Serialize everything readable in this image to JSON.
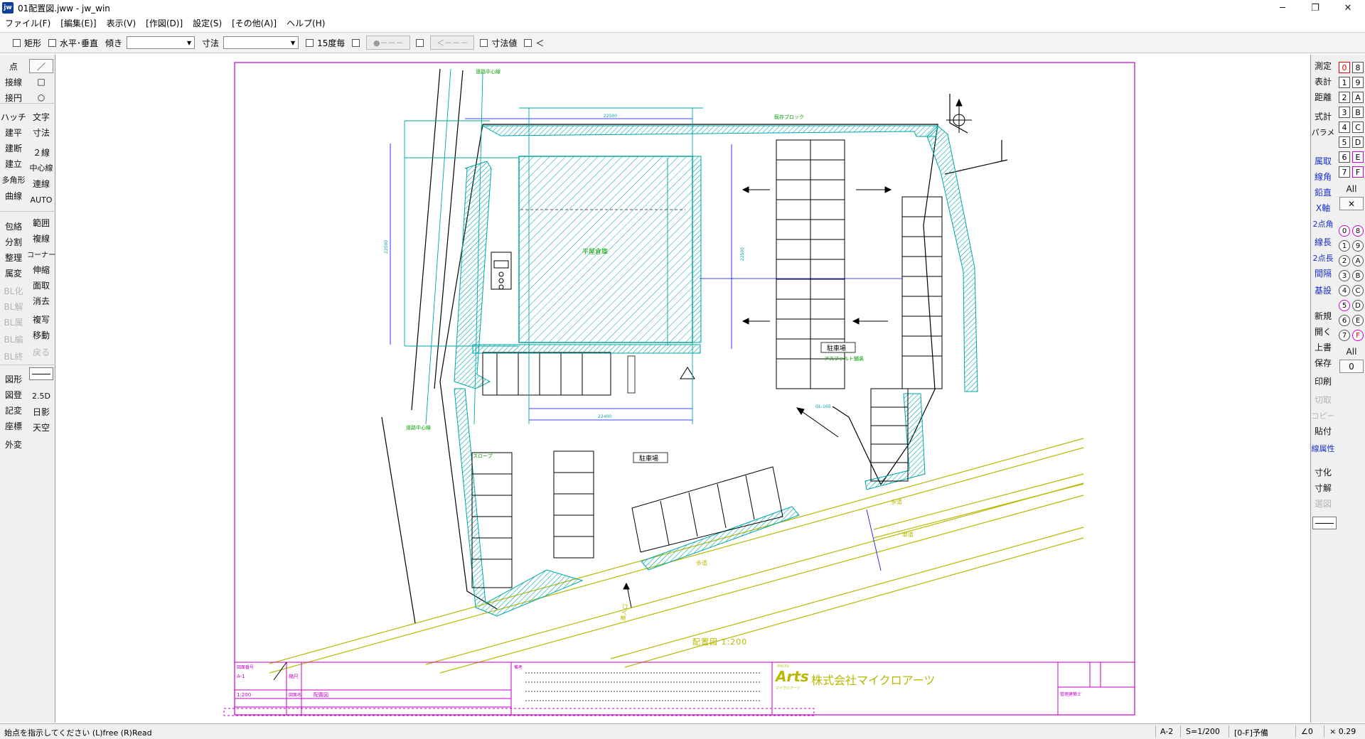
{
  "window": {
    "title": "01配置図.jww - jw_win",
    "icon_label": "jw",
    "controls": [
      "─",
      "❐",
      "✕"
    ]
  },
  "menu": [
    "ファイル(F)",
    "[編集(E)]",
    "表示(V)",
    "[作図(D)]",
    "設定(S)",
    "[その他(A)]",
    "ヘルプ(H)"
  ],
  "options_bar": {
    "rect_label": "矩形",
    "hv_label": "水平･垂直",
    "angle_label": "傾き",
    "dim_label": "寸法",
    "deg15_label": "15度毎",
    "btn1": "●－－－",
    "btn2": "＜－－－",
    "dimval_label": "寸法値",
    "last_label": "＜"
  },
  "left_toolbar": {
    "col1": [
      "点",
      "接線",
      "接円",
      "ハッチ",
      "建平",
      "建断",
      "建立",
      "多角形",
      "曲線",
      "包絡",
      "分割",
      "整理",
      "属変",
      "BL化",
      "BL解",
      "BL属",
      "BL編",
      "BL終",
      "図形",
      "図登",
      "記変",
      "座標",
      "外変"
    ],
    "col2": [
      "／",
      "□",
      "○",
      "文字",
      "寸法",
      "２線",
      "中心線",
      "連線",
      "AUTO",
      "範囲",
      "複線",
      "コーナー",
      "伸縮",
      "面取",
      "消去",
      "複写",
      "移動",
      "戻る",
      "2.5D",
      "日影",
      "天空"
    ]
  },
  "right_toolbar": {
    "cmds_a": [
      "測定",
      "表計",
      "距離",
      "式計",
      "パラメ"
    ],
    "cmds_b": [
      "属取",
      "線角",
      "鉛直",
      "X軸",
      "2点角",
      "線長",
      "2点長",
      "間隔",
      "基設"
    ],
    "cmds_c": [
      "新規",
      "開く",
      "上書",
      "保存",
      "印刷",
      "切取",
      "コピー",
      "貼付",
      "線属性",
      "寸化",
      "寸解",
      "選図"
    ],
    "layers_left": [
      "0",
      "1",
      "2",
      "3",
      "4",
      "5",
      "6",
      "7"
    ],
    "layers_right": [
      "8",
      "9",
      "A",
      "B",
      "C",
      "D",
      "E",
      "F"
    ],
    "layer_all": "All",
    "layer_x": "✕",
    "groups_left": [
      "0",
      "1",
      "2",
      "3",
      "4",
      "5",
      "6",
      "7"
    ],
    "groups_right": [
      "8",
      "9",
      "A",
      "B",
      "C",
      "D",
      "E",
      "F"
    ],
    "group_all": "All",
    "group_zero": "0"
  },
  "drawing": {
    "site_title": "配置図 1:200",
    "parking_label": "駐車場",
    "parking_label2": "駐車場",
    "parking_label3": "駐車場",
    "building_label": "平屋倉庫",
    "road_center": "道路中心線",
    "road_center2": "道路中心線",
    "entrance": "進入口",
    "sidewalk": "歩道",
    "sidewalk2": "歩道",
    "roadway": "車道",
    "block": "既存ブロック",
    "dim_top": "22500",
    "dim_left": "22500",
    "dim_mid": "22500",
    "dim_bottom": "22400",
    "slope": "スロープ",
    "gl_note": "GL-160",
    "asphalt": "アスファルト舗装"
  },
  "title_block": {
    "drawing_no_label": "図面番号",
    "drawing_no": "A-1",
    "scale_label": "縮尺",
    "scale": "1:200",
    "name_label": "図面名",
    "name": "配置図",
    "notes_label": "備考",
    "company_logo": "Arts",
    "company_logo_sub": "micro",
    "company_logo_kana": "マイクロアーツ",
    "company": "株式会社マイクロアーツ",
    "manager_label": "管理建築士"
  },
  "status": {
    "message": "始点を指示してください (L)free (R)Read",
    "paper": "A-2",
    "scale": "S=1/200",
    "layer": "[0-F]予備",
    "angle": "∠0",
    "factor": "× 0.29"
  },
  "colors": {
    "cyan": "#00a6a6",
    "yellow_green": "#b8b800",
    "magenta": "#c400c4",
    "blue_dim": "#0000ff",
    "green_text": "#00a000",
    "black": "#000000"
  }
}
